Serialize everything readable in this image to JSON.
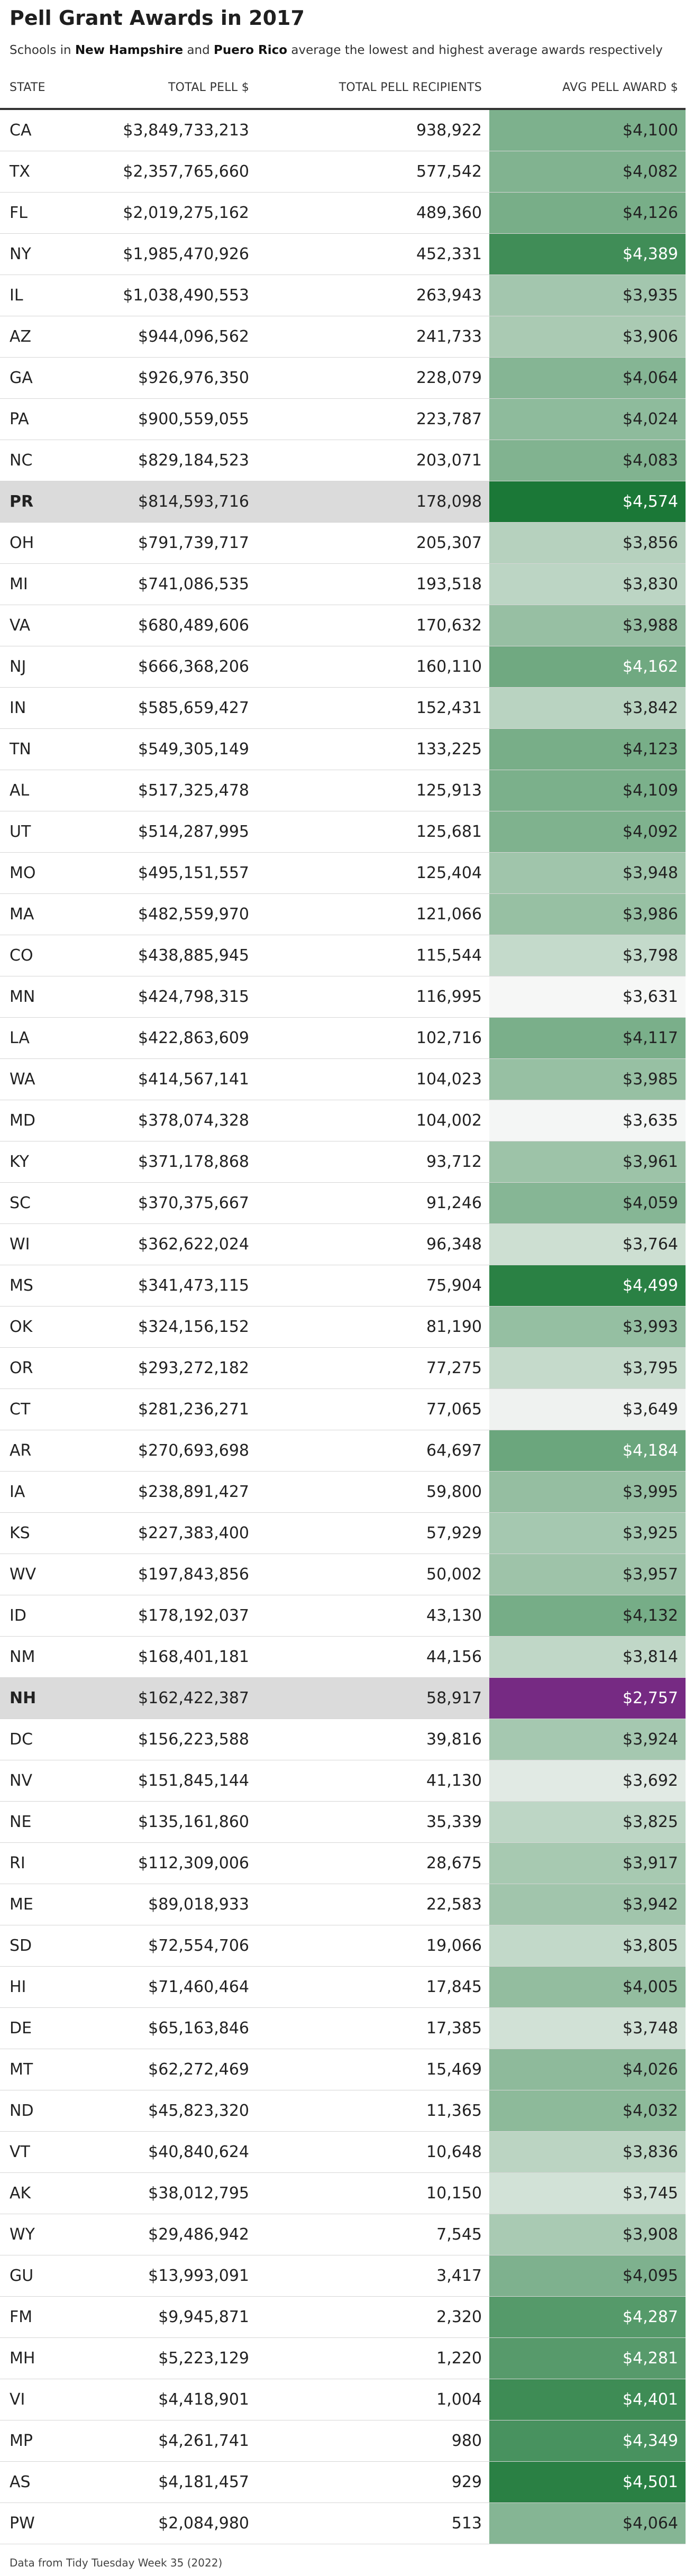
{
  "chart_data": {
    "type": "table",
    "title": "Pell Grant Awards in 2017",
    "subtitle": {
      "prefix": "Schools in ",
      "highlight_1": "New Hampshire",
      "middle": " and ",
      "highlight_2": "Puero Rico",
      "suffix": " average the lowest and highest average awards respectively"
    },
    "columns": [
      "STATE",
      "TOTAL PELL $",
      "TOTAL PELL RECIPIENTS",
      "AVG PELL AWARD $"
    ],
    "color_scale": {
      "low": "#762a83",
      "mid": "#f7f7f7",
      "high": "#1b7837",
      "low_value": 2757,
      "mid_value": 3630,
      "high_value": 4574
    },
    "highlight_color": "#dbdbdb",
    "highlighted_states": [
      "PR",
      "NH"
    ],
    "rows": [
      {
        "state": "CA",
        "total": "$3,849,733,213",
        "recipients": "938,922",
        "avg": 4100
      },
      {
        "state": "TX",
        "total": "$2,357,765,660",
        "recipients": "577,542",
        "avg": 4082
      },
      {
        "state": "FL",
        "total": "$2,019,275,162",
        "recipients": "489,360",
        "avg": 4126
      },
      {
        "state": "NY",
        "total": "$1,985,470,926",
        "recipients": "452,331",
        "avg": 4389
      },
      {
        "state": "IL",
        "total": "$1,038,490,553",
        "recipients": "263,943",
        "avg": 3935
      },
      {
        "state": "AZ",
        "total": "$944,096,562",
        "recipients": "241,733",
        "avg": 3906
      },
      {
        "state": "GA",
        "total": "$926,976,350",
        "recipients": "228,079",
        "avg": 4064
      },
      {
        "state": "PA",
        "total": "$900,559,055",
        "recipients": "223,787",
        "avg": 4024
      },
      {
        "state": "NC",
        "total": "$829,184,523",
        "recipients": "203,071",
        "avg": 4083
      },
      {
        "state": "PR",
        "total": "$814,593,716",
        "recipients": "178,098",
        "avg": 4574
      },
      {
        "state": "OH",
        "total": "$791,739,717",
        "recipients": "205,307",
        "avg": 3856
      },
      {
        "state": "MI",
        "total": "$741,086,535",
        "recipients": "193,518",
        "avg": 3830
      },
      {
        "state": "VA",
        "total": "$680,489,606",
        "recipients": "170,632",
        "avg": 3988
      },
      {
        "state": "NJ",
        "total": "$666,368,206",
        "recipients": "160,110",
        "avg": 4162
      },
      {
        "state": "IN",
        "total": "$585,659,427",
        "recipients": "152,431",
        "avg": 3842
      },
      {
        "state": "TN",
        "total": "$549,305,149",
        "recipients": "133,225",
        "avg": 4123
      },
      {
        "state": "AL",
        "total": "$517,325,478",
        "recipients": "125,913",
        "avg": 4109
      },
      {
        "state": "UT",
        "total": "$514,287,995",
        "recipients": "125,681",
        "avg": 4092
      },
      {
        "state": "MO",
        "total": "$495,151,557",
        "recipients": "125,404",
        "avg": 3948
      },
      {
        "state": "MA",
        "total": "$482,559,970",
        "recipients": "121,066",
        "avg": 3986
      },
      {
        "state": "CO",
        "total": "$438,885,945",
        "recipients": "115,544",
        "avg": 3798
      },
      {
        "state": "MN",
        "total": "$424,798,315",
        "recipients": "116,995",
        "avg": 3631
      },
      {
        "state": "LA",
        "total": "$422,863,609",
        "recipients": "102,716",
        "avg": 4117
      },
      {
        "state": "WA",
        "total": "$414,567,141",
        "recipients": "104,023",
        "avg": 3985
      },
      {
        "state": "MD",
        "total": "$378,074,328",
        "recipients": "104,002",
        "avg": 3635
      },
      {
        "state": "KY",
        "total": "$371,178,868",
        "recipients": "93,712",
        "avg": 3961
      },
      {
        "state": "SC",
        "total": "$370,375,667",
        "recipients": "91,246",
        "avg": 4059
      },
      {
        "state": "WI",
        "total": "$362,622,024",
        "recipients": "96,348",
        "avg": 3764
      },
      {
        "state": "MS",
        "total": "$341,473,115",
        "recipients": "75,904",
        "avg": 4499
      },
      {
        "state": "OK",
        "total": "$324,156,152",
        "recipients": "81,190",
        "avg": 3993
      },
      {
        "state": "OR",
        "total": "$293,272,182",
        "recipients": "77,275",
        "avg": 3795
      },
      {
        "state": "CT",
        "total": "$281,236,271",
        "recipients": "77,065",
        "avg": 3649
      },
      {
        "state": "AR",
        "total": "$270,693,698",
        "recipients": "64,697",
        "avg": 4184
      },
      {
        "state": "IA",
        "total": "$238,891,427",
        "recipients": "59,800",
        "avg": 3995
      },
      {
        "state": "KS",
        "total": "$227,383,400",
        "recipients": "57,929",
        "avg": 3925
      },
      {
        "state": "WV",
        "total": "$197,843,856",
        "recipients": "50,002",
        "avg": 3957
      },
      {
        "state": "ID",
        "total": "$178,192,037",
        "recipients": "43,130",
        "avg": 4132
      },
      {
        "state": "NM",
        "total": "$168,401,181",
        "recipients": "44,156",
        "avg": 3814
      },
      {
        "state": "NH",
        "total": "$162,422,387",
        "recipients": "58,917",
        "avg": 2757
      },
      {
        "state": "DC",
        "total": "$156,223,588",
        "recipients": "39,816",
        "avg": 3924
      },
      {
        "state": "NV",
        "total": "$151,845,144",
        "recipients": "41,130",
        "avg": 3692
      },
      {
        "state": "NE",
        "total": "$135,161,860",
        "recipients": "35,339",
        "avg": 3825
      },
      {
        "state": "RI",
        "total": "$112,309,006",
        "recipients": "28,675",
        "avg": 3917
      },
      {
        "state": "ME",
        "total": "$89,018,933",
        "recipients": "22,583",
        "avg": 3942
      },
      {
        "state": "SD",
        "total": "$72,554,706",
        "recipients": "19,066",
        "avg": 3805
      },
      {
        "state": "HI",
        "total": "$71,460,464",
        "recipients": "17,845",
        "avg": 4005
      },
      {
        "state": "DE",
        "total": "$65,163,846",
        "recipients": "17,385",
        "avg": 3748
      },
      {
        "state": "MT",
        "total": "$62,272,469",
        "recipients": "15,469",
        "avg": 4026
      },
      {
        "state": "ND",
        "total": "$45,823,320",
        "recipients": "11,365",
        "avg": 4032
      },
      {
        "state": "VT",
        "total": "$40,840,624",
        "recipients": "10,648",
        "avg": 3836
      },
      {
        "state": "AK",
        "total": "$38,012,795",
        "recipients": "10,150",
        "avg": 3745
      },
      {
        "state": "WY",
        "total": "$29,486,942",
        "recipients": "7,545",
        "avg": 3908
      },
      {
        "state": "GU",
        "total": "$13,993,091",
        "recipients": "3,417",
        "avg": 4095
      },
      {
        "state": "FM",
        "total": "$9,945,871",
        "recipients": "2,320",
        "avg": 4287
      },
      {
        "state": "MH",
        "total": "$5,223,129",
        "recipients": "1,220",
        "avg": 4281
      },
      {
        "state": "VI",
        "total": "$4,418,901",
        "recipients": "1,004",
        "avg": 4401
      },
      {
        "state": "MP",
        "total": "$4,261,741",
        "recipients": "980",
        "avg": 4349
      },
      {
        "state": "AS",
        "total": "$4,181,457",
        "recipients": "929",
        "avg": 4501
      },
      {
        "state": "PW",
        "total": "$2,084,980",
        "recipients": "513",
        "avg": 4064
      }
    ],
    "source": "Data from Tidy Tuesday Week 35 (2022)"
  }
}
